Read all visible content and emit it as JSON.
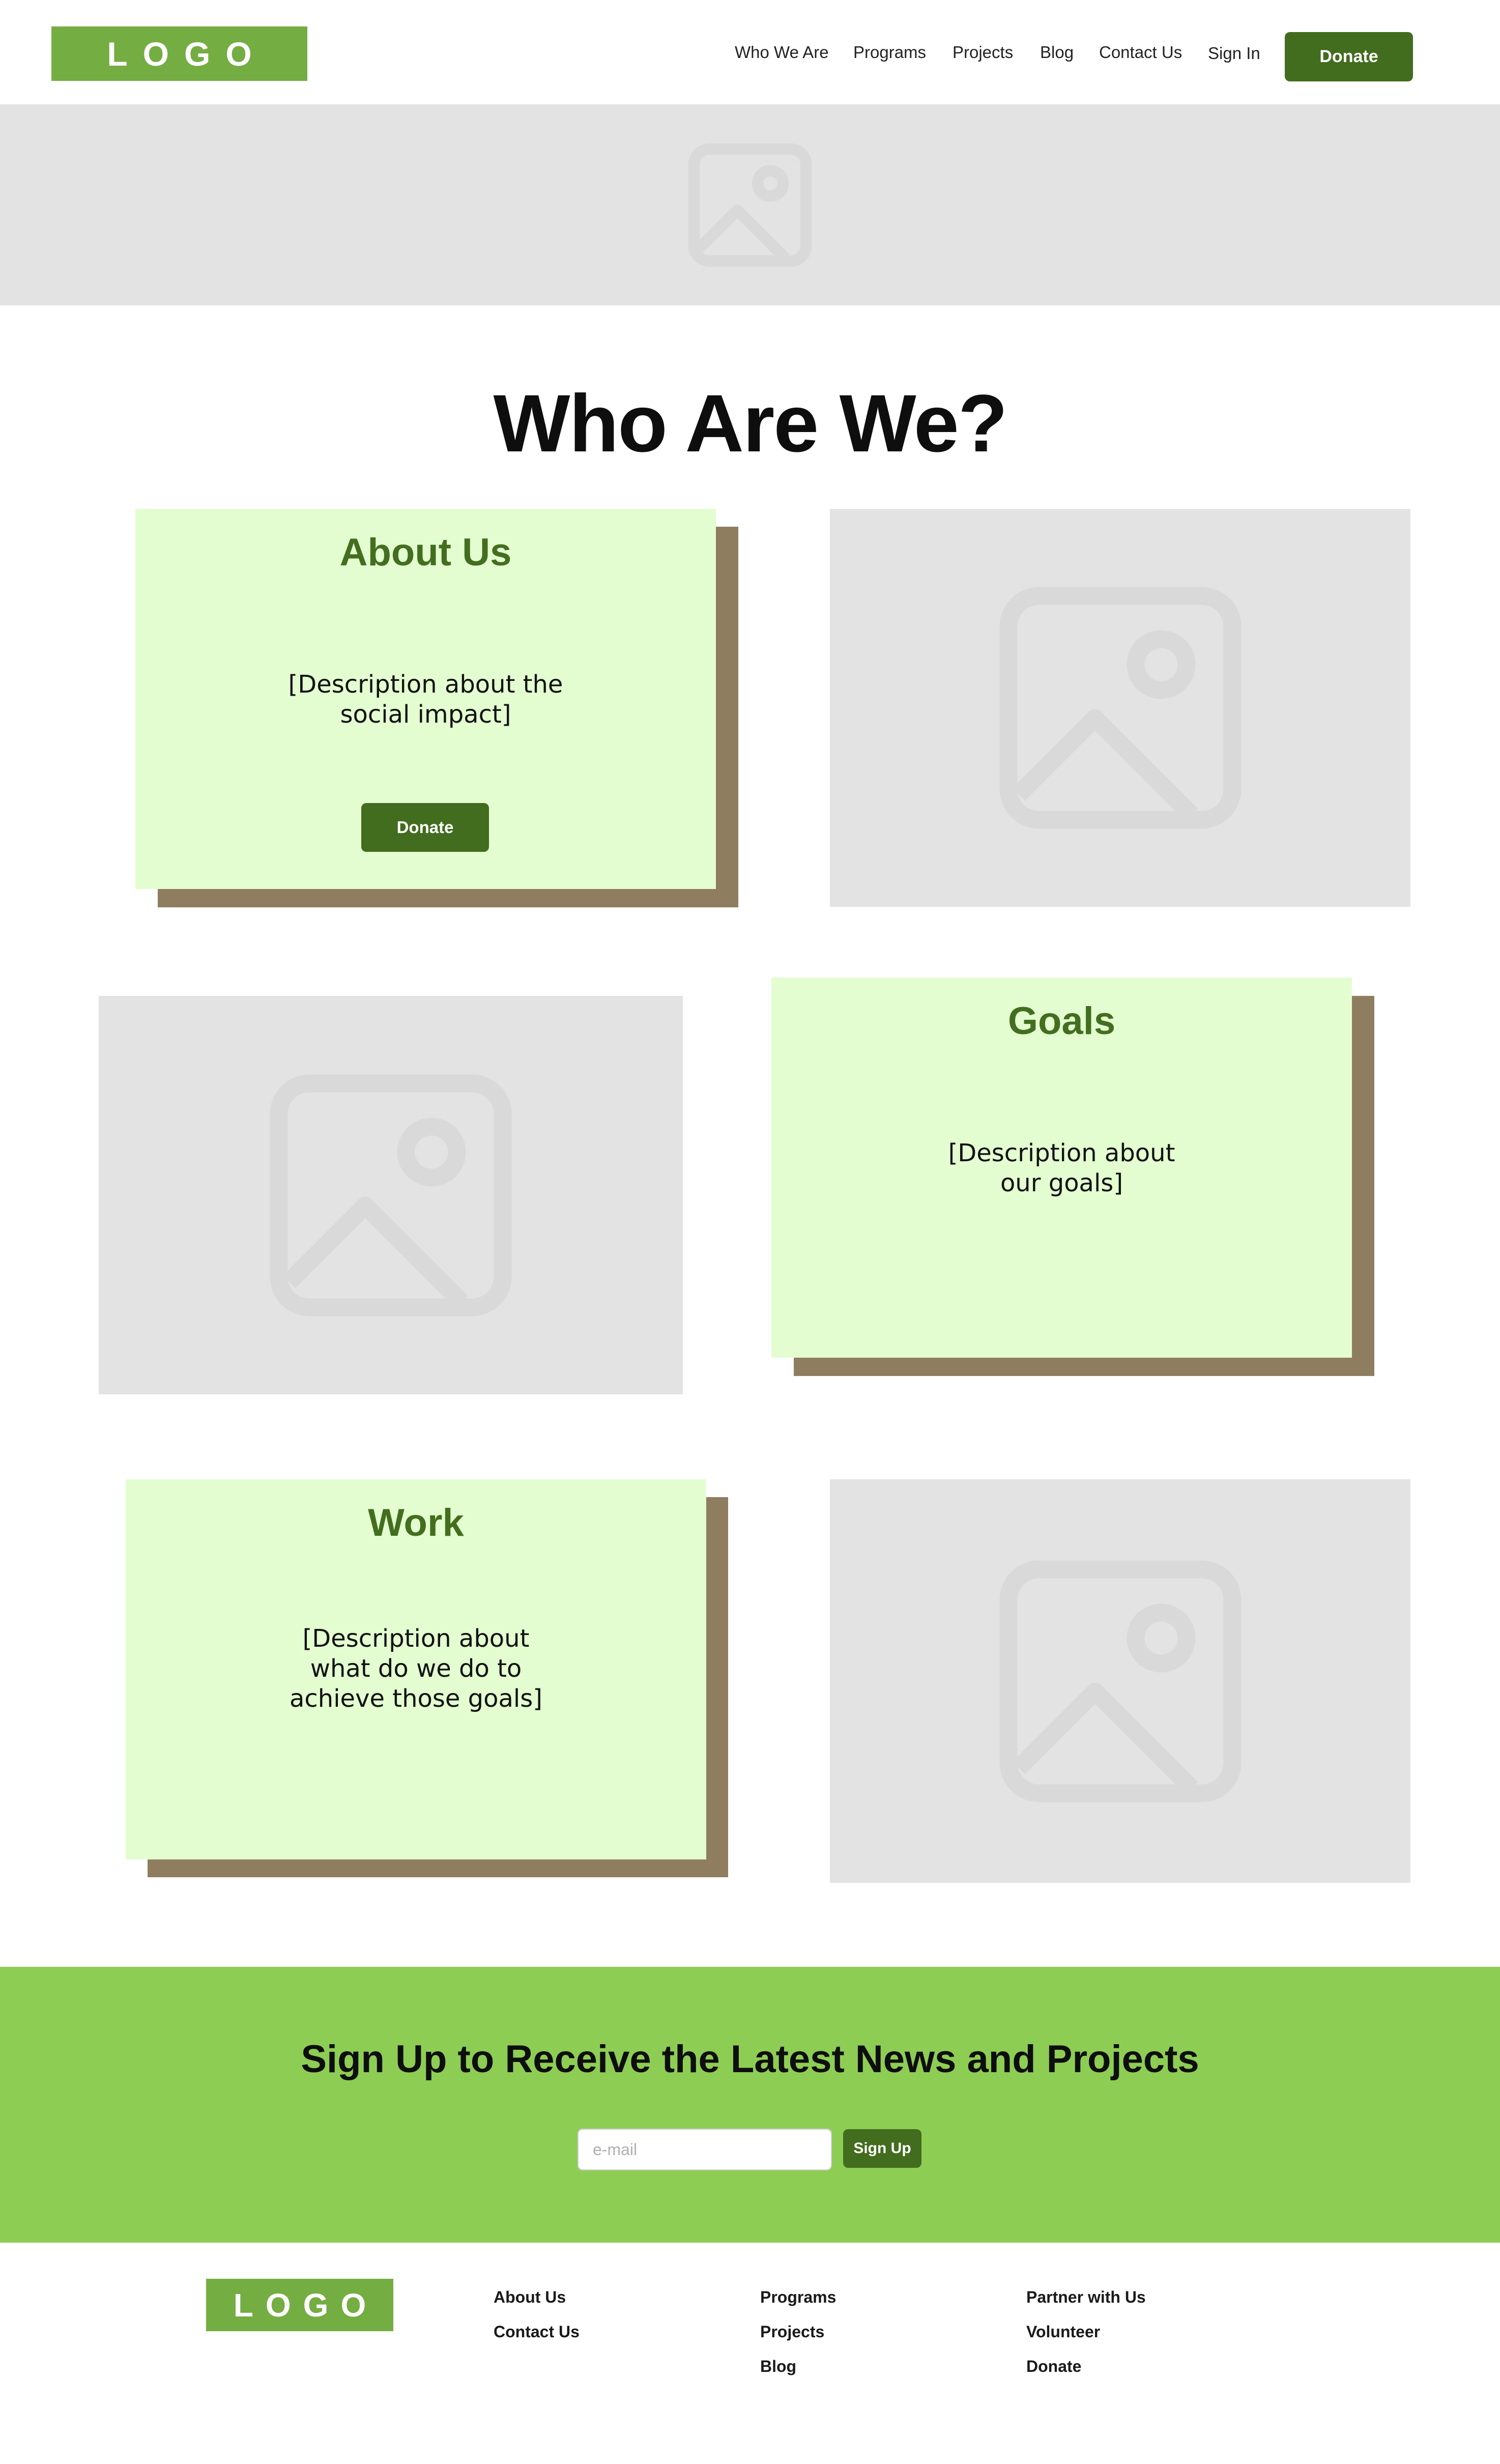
{
  "header": {
    "logo_text": "LOGO",
    "nav": [
      "Who We Are",
      "Programs",
      "Projects",
      "Blog",
      "Contact Us"
    ],
    "sign_in": "Sign In",
    "donate": "Donate"
  },
  "hero": {
    "image_icon": "image-placeholder-icon"
  },
  "main": {
    "title": "Who Are We?",
    "sections": [
      {
        "title": "About Us",
        "description": "[Description about the\nsocial impact]",
        "button": "Donate"
      },
      {
        "title": "Goals",
        "description": "[Description about\nour goals]"
      },
      {
        "title": "Work",
        "description": "[Description about\nwhat do we do to\nachieve those goals]"
      }
    ]
  },
  "signup": {
    "title": "Sign Up to Receive the Latest News and Projects",
    "email_placeholder": "e-mail",
    "button": "Sign Up"
  },
  "footer": {
    "logo_text": "LOGO",
    "columns": [
      [
        "About Us",
        "Contact Us"
      ],
      [
        "Programs",
        "Projects",
        "Blog"
      ],
      [
        "Partner with Us",
        "Volunteer",
        "Donate"
      ]
    ]
  },
  "colors": {
    "brand_green": "#74ad42",
    "dark_green": "#426c1e",
    "signup_green": "#8dcd54",
    "card_bg": "#e3fdd0",
    "card_shadow": "#8f7d5f",
    "placeholder_gray": "#e3e3e3"
  }
}
